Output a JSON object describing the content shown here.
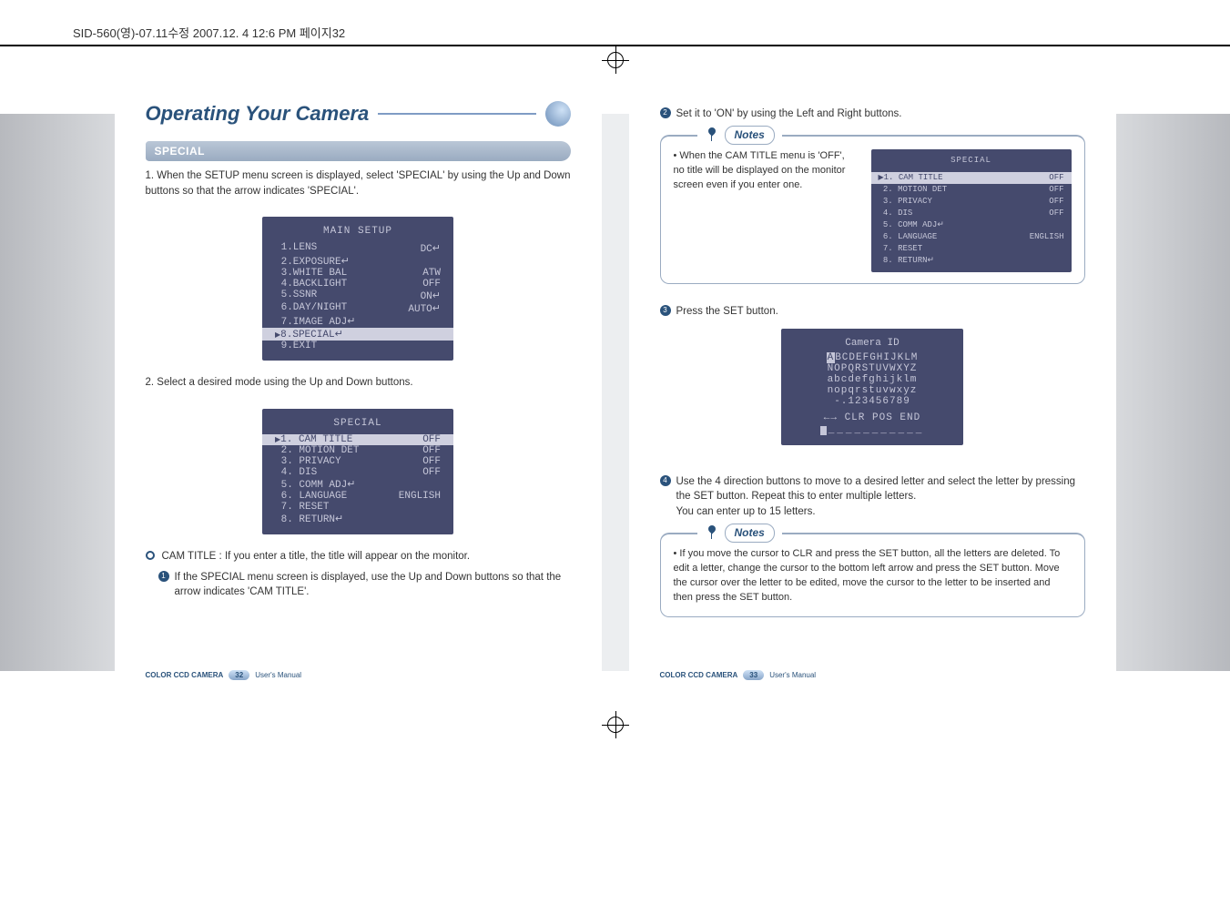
{
  "print_header": "SID-560(영)-07.11수정  2007.12. 4 12:6 PM  페이지32",
  "left": {
    "chapter": "Operating Your Camera",
    "section": "SPECIAL",
    "p1": "1. When the SETUP menu screen is displayed, select 'SPECIAL' by using the Up and Down buttons so that the arrow indicates 'SPECIAL'.",
    "osd1": {
      "title": "MAIN SETUP",
      "rows": [
        {
          "lbl": "1.LENS",
          "val": "DC↵"
        },
        {
          "lbl": "2.EXPOSURE↵",
          "val": ""
        },
        {
          "lbl": "3.WHITE BAL",
          "val": "ATW"
        },
        {
          "lbl": "4.BACKLIGHT",
          "val": "OFF"
        },
        {
          "lbl": "5.SSNR",
          "val": "ON↵"
        },
        {
          "lbl": "6.DAY/NIGHT",
          "val": "AUTO↵"
        },
        {
          "lbl": "7.IMAGE ADJ↵",
          "val": ""
        },
        {
          "lbl": "8.SPECIAL↵",
          "val": "",
          "sel": true
        },
        {
          "lbl": "9.EXIT",
          "val": ""
        }
      ]
    },
    "p2": "2. Select a desired mode using the Up and Down buttons.",
    "osd2": {
      "title": "SPECIAL",
      "rows": [
        {
          "lbl": "1. CAM TITLE",
          "val": "OFF",
          "sel": true
        },
        {
          "lbl": "2. MOTION DET",
          "val": "OFF"
        },
        {
          "lbl": "3. PRIVACY",
          "val": "OFF"
        },
        {
          "lbl": "4. DIS",
          "val": "OFF"
        },
        {
          "lbl": "5. COMM ADJ↵",
          "val": ""
        },
        {
          "lbl": "6. LANGUAGE",
          "val": "ENGLISH"
        },
        {
          "lbl": "7. RESET",
          "val": ""
        },
        {
          "lbl": "8. RETURN↵",
          "val": ""
        }
      ]
    },
    "b1": "CAM TITLE : If you enter a title, the title will appear on the monitor.",
    "n1": "If the SPECIAL menu screen is displayed, use the Up and Down buttons so that the arrow indicates 'CAM TITLE'.",
    "footer_lead": "COLOR CCD CAMERA",
    "page_no": "32",
    "footer_tail": "User's Manual"
  },
  "right": {
    "n2": "Set it to 'ON' by using the Left and Right buttons.",
    "notes_label": "Notes",
    "note1": "When the CAM TITLE menu is 'OFF', no title will be displayed on the monitor screen even if you enter one.",
    "osd3": {
      "title": "SPECIAL",
      "rows": [
        {
          "lbl": "1. CAM TITLE",
          "val": "OFF",
          "sel": true
        },
        {
          "lbl": "2. MOTION DET",
          "val": "OFF"
        },
        {
          "lbl": "3. PRIVACY",
          "val": "OFF"
        },
        {
          "lbl": "4. DIS",
          "val": "OFF"
        },
        {
          "lbl": "5. COMM ADJ↵",
          "val": ""
        },
        {
          "lbl": "6. LANGUAGE",
          "val": "ENGLISH"
        },
        {
          "lbl": "7. RESET",
          "val": ""
        },
        {
          "lbl": "8. RETURN↵",
          "val": ""
        }
      ]
    },
    "n3": "Press the SET button.",
    "osd4": {
      "title": "Camera ID",
      "lines": [
        "ABCDEFGHIJKLM",
        "NOPQRSTUVWXYZ",
        "abcdefghijklm",
        "nopqrstuvwxyz",
        "-.123456789"
      ],
      "actions": "←→ CLR POS END",
      "dash": "___________"
    },
    "n4": "Use the 4 direction buttons to move to a desired letter and select the letter by pressing the SET button. Repeat this to enter multiple letters.",
    "n4b": "You can enter up to 15 letters.",
    "note2": "If you move the cursor to CLR and press the SET button, all the letters are deleted. To edit a letter, change the cursor to the bottom left arrow and press the SET button. Move the cursor over the letter to be edited, move the cursor to the letter to be inserted and then press the SET button.",
    "footer_lead": "COLOR CCD CAMERA",
    "page_no": "33",
    "footer_tail": "User's Manual"
  }
}
